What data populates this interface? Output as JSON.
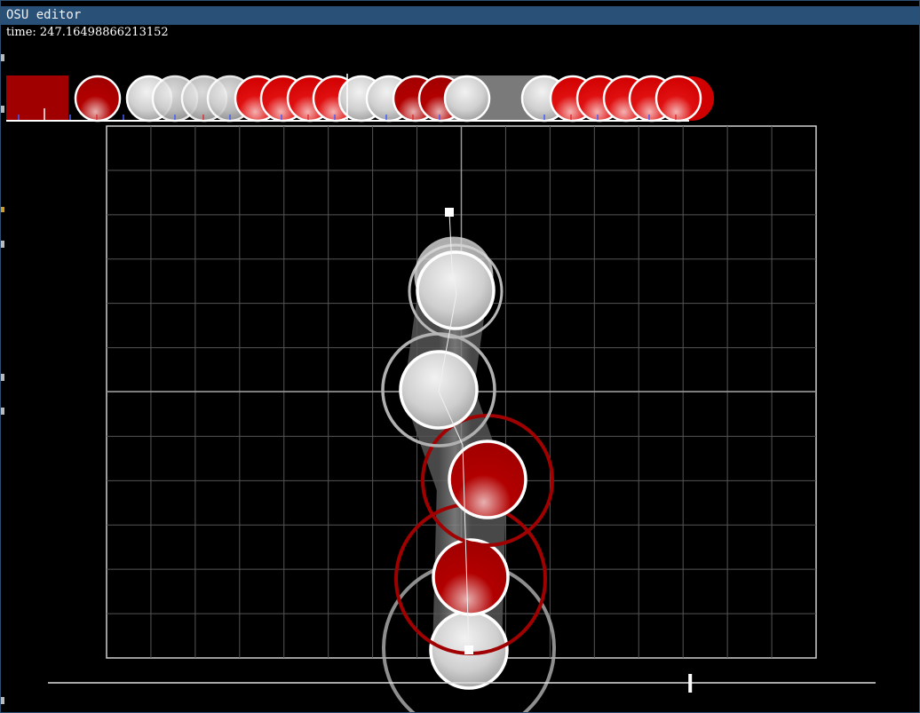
{
  "window": {
    "title": "OSU editor"
  },
  "status": {
    "time_label": "time: 247.16498866213152"
  },
  "playfield": {
    "grid": true,
    "grid_columns": 16,
    "grid_rows": 12
  },
  "timeline": {
    "hit_objects": [
      {
        "kind": "slider-body",
        "color": "dark-red"
      },
      {
        "kind": "circle",
        "color": "dark-red"
      },
      {
        "kind": "circle",
        "color": "white"
      },
      {
        "kind": "circle",
        "color": "white"
      },
      {
        "kind": "circle",
        "color": "white"
      },
      {
        "kind": "circle",
        "color": "white"
      },
      {
        "kind": "circle",
        "color": "red"
      },
      {
        "kind": "circle",
        "color": "red"
      },
      {
        "kind": "circle",
        "color": "red"
      },
      {
        "kind": "circle",
        "color": "red"
      },
      {
        "kind": "circle",
        "color": "white"
      },
      {
        "kind": "circle",
        "color": "white"
      },
      {
        "kind": "circle",
        "color": "dark-red"
      },
      {
        "kind": "circle",
        "color": "dark-red"
      },
      {
        "kind": "circle",
        "color": "white"
      },
      {
        "kind": "slider-body",
        "color": "white"
      },
      {
        "kind": "circle",
        "color": "white"
      },
      {
        "kind": "circle",
        "color": "red"
      },
      {
        "kind": "circle",
        "color": "red"
      },
      {
        "kind": "circle",
        "color": "red"
      },
      {
        "kind": "circle",
        "color": "red"
      },
      {
        "kind": "circle",
        "color": "red"
      }
    ]
  },
  "scrubber": {
    "progress": 0.776
  },
  "colors": {
    "title_bar": "#295077",
    "window_border": "#2c4f72",
    "grid_line": "#555555",
    "red": "#e0141b",
    "dark_red": "#a00000",
    "white_circle": "#d9d9d9",
    "slider_body": "#7a7a7a"
  }
}
